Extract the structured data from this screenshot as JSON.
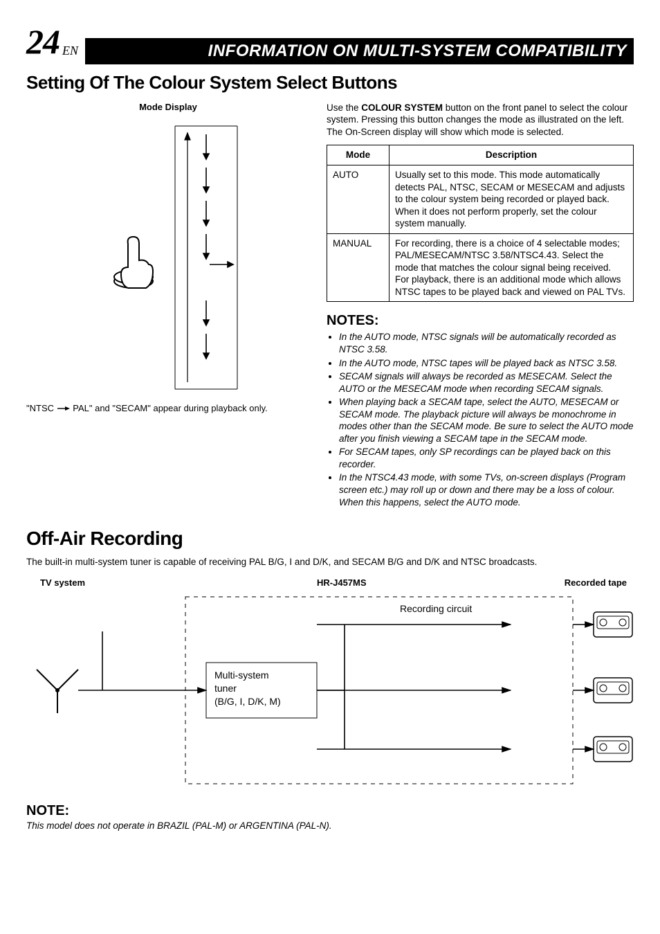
{
  "header": {
    "page_number": "24",
    "page_lang": "EN",
    "banner": "INFORMATION ON MULTI-SYSTEM COMPATIBILITY"
  },
  "section1": {
    "title": "Setting Of The Colour System Select Buttons",
    "left": {
      "mode_display_label": "Mode Display",
      "caption_prefix": "\"NTSC",
      "caption_mid": "PAL\" and \"SECAM\" appear during playback only."
    },
    "right": {
      "intro_pre": "Use the ",
      "intro_bold": "COLOUR SYSTEM",
      "intro_post": " button on the front panel to select the colour system. Pressing this button changes the mode as illustrated on the left. The On-Screen display will show which mode is selected.",
      "table": {
        "head_mode": "Mode",
        "head_desc": "Description",
        "rows": [
          {
            "mode": "AUTO",
            "desc": "Usually set to this mode. This mode automatically detects PAL, NTSC, SECAM or MESECAM and adjusts to the colour system being recorded or played back. When it does not perform properly, set the colour system manually."
          },
          {
            "mode": "MANUAL",
            "desc": "For recording, there is a choice of 4 selectable modes; PAL/MESECAM/NTSC 3.58/NTSC4.43. Select the mode that matches the colour signal being received. For playback, there is an additional mode which allows NTSC tapes to be played back and viewed on PAL TVs."
          }
        ]
      },
      "notes_heading": "NOTES:",
      "notes": [
        "In the AUTO mode, NTSC signals will be automatically recorded as NTSC 3.58.",
        "In the AUTO mode, NTSC tapes will be played back as NTSC 3.58.",
        "SECAM signals will always be recorded as MESECAM. Select the AUTO or the MESECAM mode when recording SECAM signals.",
        "When playing back a SECAM tape, select the AUTO, MESECAM or SECAM mode. The playback picture will always be monochrome in modes other than the SECAM mode. Be sure to select the AUTO mode after you finish viewing a SECAM tape in the SECAM mode.",
        "For SECAM tapes, only SP recordings can be played back on this recorder.",
        "In the NTSC4.43 mode, with some TVs, on-screen displays (Program screen etc.) may roll up or down and there may be a loss of colour. When this happens, select the AUTO mode."
      ]
    }
  },
  "section2": {
    "title": "Off-Air Recording",
    "intro": "The built-in multi-system tuner is capable of receiving PAL B/G, I and D/K, and SECAM B/G and D/K and NTSC broadcasts.",
    "diagram": {
      "label_tv": "TV system",
      "label_model": "HR-J457MS",
      "label_tape": "Recorded tape",
      "recording_circuit": "Recording circuit",
      "tuner_l1": "Multi-system",
      "tuner_l2": "tuner",
      "tuner_l3": "(B/G, I, D/K, M)"
    },
    "note_heading": "NOTE:",
    "note_text": "This model does not operate in BRAZIL (PAL-M) or ARGENTINA (PAL-N)."
  }
}
